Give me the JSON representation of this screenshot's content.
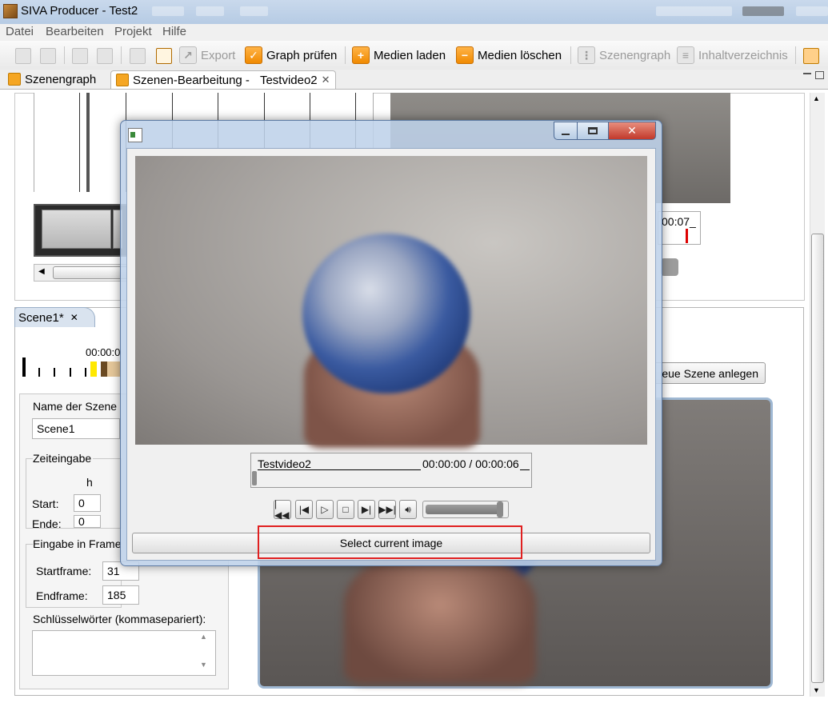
{
  "window": {
    "title": "SIVA Producer - Test2"
  },
  "menu": [
    "Datei",
    "Bearbeiten",
    "Projekt",
    "Hilfe"
  ],
  "toolbar": {
    "export": "Export",
    "check_graph": "Graph prüfen",
    "load_media": "Medien laden",
    "delete_media": "Medien löschen",
    "scene_graph": "Szenengraph",
    "toc": "Inhaltverzeichnis"
  },
  "editor_tabs": {
    "tab1": "Szenengraph",
    "tab2_prefix": "Szenen-Bearbeitung -",
    "tab2_file": "Testvideo2"
  },
  "upper_panel": {
    "time_partial": "00:07_"
  },
  "scene": {
    "tab_label": "Scene1*",
    "time": "00:00:0",
    "name_label": "Name der Szene",
    "name_value": "Scene1",
    "time_group": "Zeiteingabe",
    "hour_header": "h",
    "start_label": "Start:",
    "end_label": "Ende:",
    "start_h": "0",
    "end_h": "0",
    "frame_group": "Eingabe in Frame",
    "startframe_label": "Startframe:",
    "startframe_value": "31",
    "endframe_label": "Endframe:",
    "endframe_value": "185",
    "keywords_label": "Schlüsselwörter (kommasepariert):",
    "new_scene_button": "eue Szene anlegen"
  },
  "player": {
    "media_name": "Testvideo2",
    "time_display": "00:00:00 / 00:00:06",
    "select_button": "Select current image",
    "volume": 0.95
  },
  "colors": {
    "highlight": "#e02020",
    "accent": "#f08a00"
  }
}
